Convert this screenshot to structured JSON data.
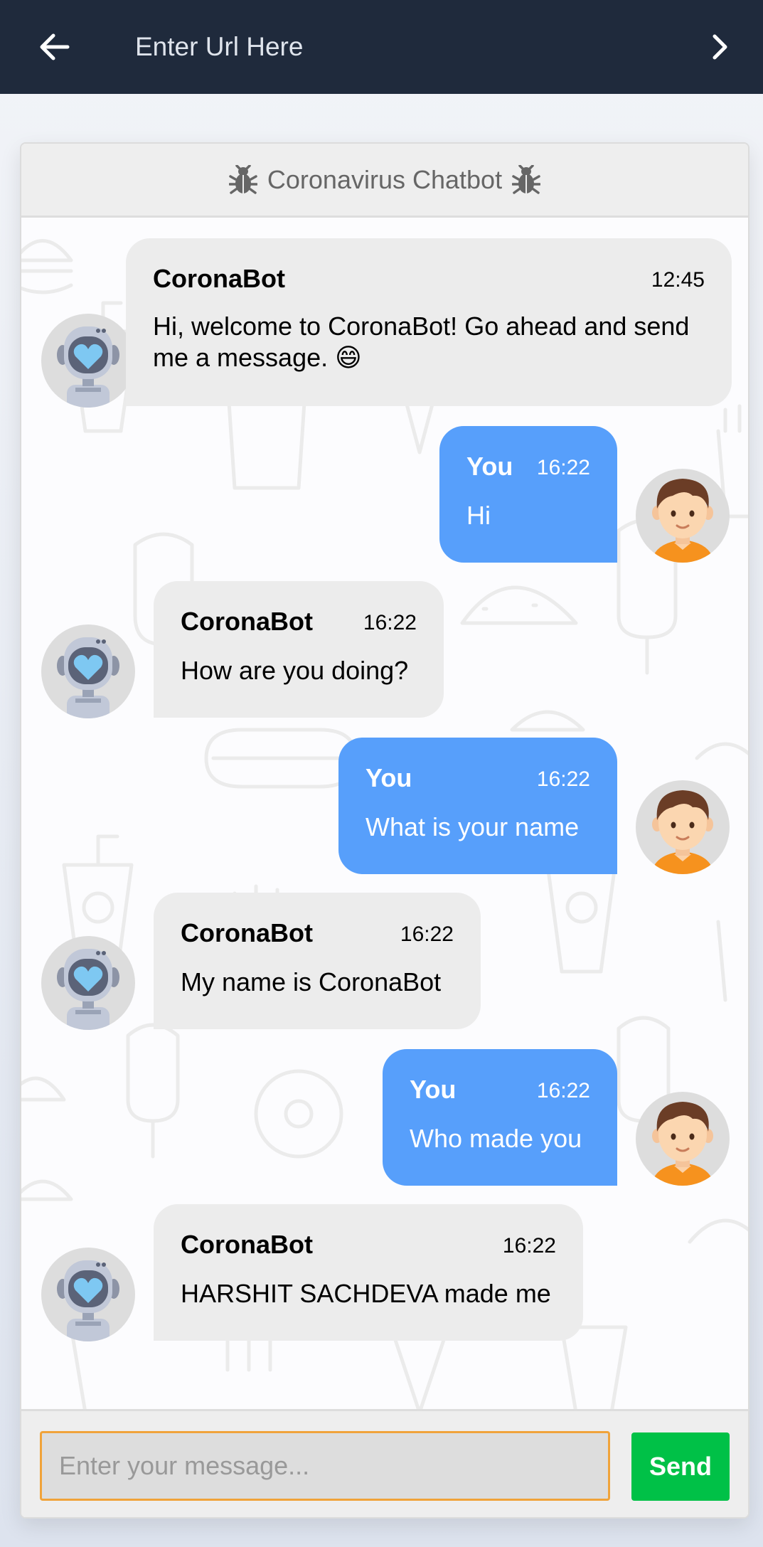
{
  "browser": {
    "url_placeholder": "Enter Url Here",
    "back_icon": "arrow-left-icon",
    "forward_icon": "chevron-right-icon"
  },
  "chat": {
    "title": "Coronavirus Chatbot",
    "title_icon": "bug-icon",
    "messages": [
      {
        "sender": "CoronaBot",
        "side": "left",
        "time": "12:45",
        "text": "Hi, welcome to CoronaBot! Go ahead and send me a message. 😄"
      },
      {
        "sender": "You",
        "side": "right",
        "time": "16:22",
        "text": "Hi"
      },
      {
        "sender": "CoronaBot",
        "side": "left",
        "time": "16:22",
        "text": "How are you doing?"
      },
      {
        "sender": "You",
        "side": "right",
        "time": "16:22",
        "text": "What is your name"
      },
      {
        "sender": "CoronaBot",
        "side": "left",
        "time": "16:22",
        "text": "My name is CoronaBot"
      },
      {
        "sender": "You",
        "side": "right",
        "time": "16:22",
        "text": "Who made you"
      },
      {
        "sender": "CoronaBot",
        "side": "left",
        "time": "16:22",
        "text": "HARSHIT SACHDEVA made me"
      }
    ],
    "input_placeholder": "Enter your message...",
    "send_label": "Send"
  },
  "colors": {
    "topbar": "#1f2a3c",
    "bot_bubble": "#ececec",
    "user_bubble": "#579ffb",
    "send_button": "#00c147",
    "input_border": "#f0a33a"
  }
}
